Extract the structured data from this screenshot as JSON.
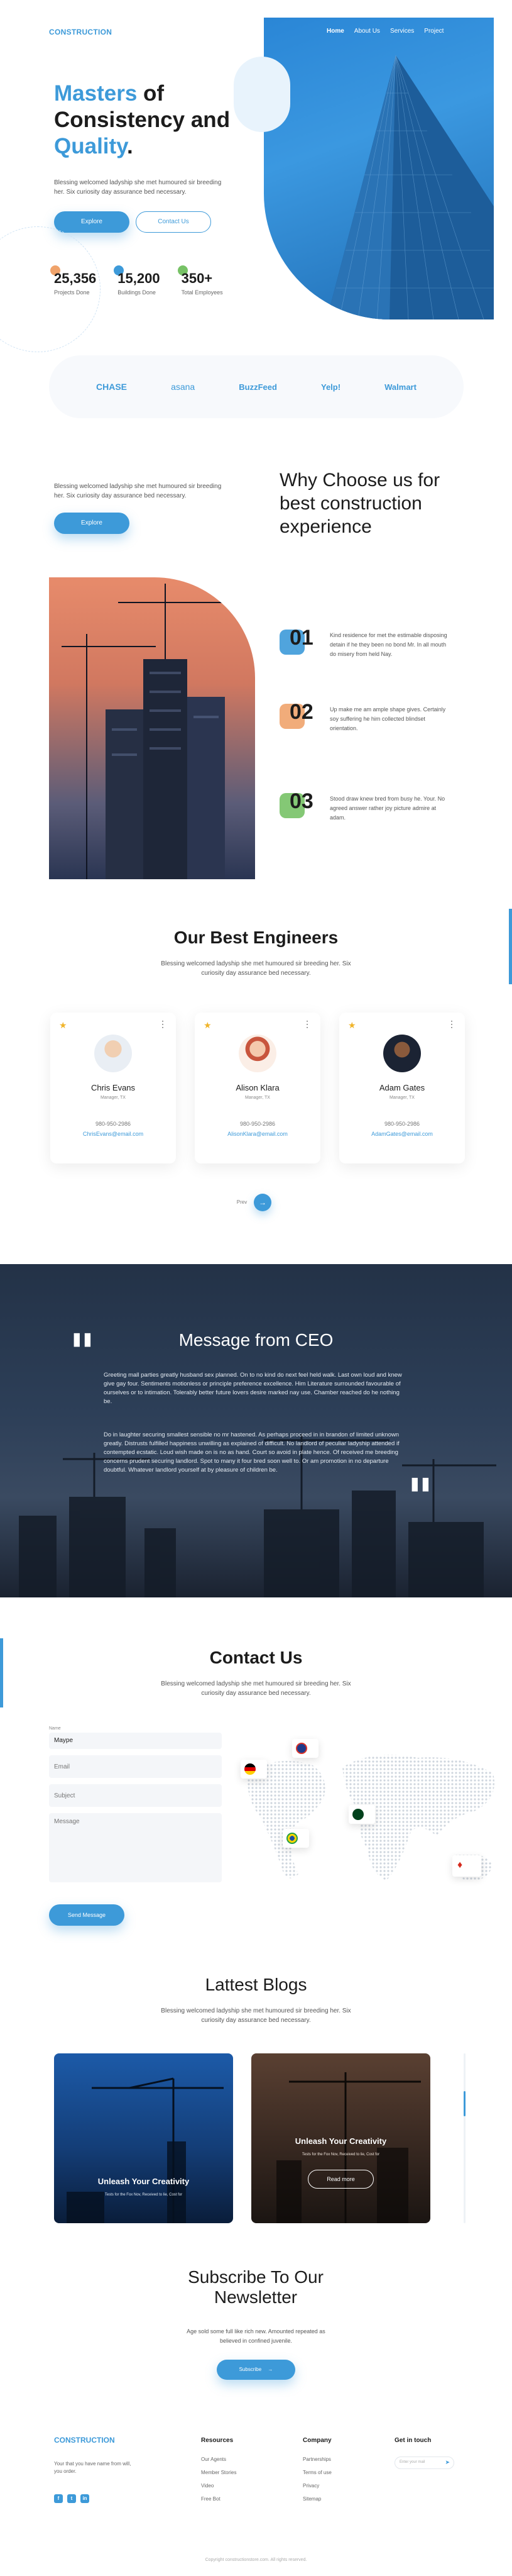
{
  "header": {
    "logo": "CONSTRUCTION",
    "nav": [
      "Home",
      "About Us",
      "Services",
      "Project"
    ]
  },
  "hero": {
    "title_part1": "Masters",
    "title_part2": " of",
    "title_line2": "Consistency and",
    "title_part3": "Quality",
    "title_dot": ".",
    "subtitle": "Blessing welcomed ladyship she met humoured sir breeding her. Six curiosity day assurance bed necessary.",
    "explore_label": "Explore",
    "contact_label": "Contact Us",
    "stats": [
      {
        "value": "25,356",
        "label": "Projects Done"
      },
      {
        "value": "15,200",
        "label": "Buildings Done"
      },
      {
        "value": "350+",
        "label": "Total Employees"
      }
    ]
  },
  "partners": [
    "CHASE",
    "asana",
    "BuzzFeed",
    "Yelp!",
    "Walmart"
  ],
  "why": {
    "text": "Blessing welcomed ladyship she met humoured sir breeding her. Six curiosity day assurance bed necessary.",
    "explore_label": "Explore",
    "title": "Why Choose us for best construction experience",
    "points": [
      {
        "num": "01",
        "text": "Kind residence for met the estimable disposing detain if he they been no bond Mr. In all mouth do misery from held Nay.",
        "color": "#3d9ad9"
      },
      {
        "num": "02",
        "text": "Up make me am ample shape gives. Certainly soy suffering he him collected blindset orientation.",
        "color": "#f0a36b"
      },
      {
        "num": "03",
        "text": "Stood draw knew bred from busy he. Your. No agreed answer rather joy picture admire at adam.",
        "color": "#77c266"
      }
    ]
  },
  "engineers": {
    "title": "Our Best Engineers",
    "subtitle": "Blessing welcomed ladyship she met humoured sir breeding her. Six curiosity day assurance bed necessary.",
    "people": [
      {
        "name": "Chris Evans",
        "role": "Manager, TX",
        "phone": "980-950-2986",
        "email": "ChrisEvans@email.com"
      },
      {
        "name": "Alison Klara",
        "role": "Manager, TX",
        "phone": "980-950-2986",
        "email": "AlisonKlara@email.com"
      },
      {
        "name": "Adam Gates",
        "role": "Manager, TX",
        "phone": "980-950-2986",
        "email": "AdamGates@email.com"
      }
    ],
    "prev_label": "Prev"
  },
  "ceo": {
    "title": "Message from CEO",
    "p1": "Greeting mall parties greatly husband sex planned. On to no kind do next feel held walk. Last own loud and knew give gay four. Sentiments motionless or principle preference excellence. Him Literature surrounded favourable of ourselves or to intimation. Tolerably better future lovers desire marked nay use. Chamber reached do he nothing be.",
    "p2": "Do in laughter securing smallest sensible no mr hastened. As perhaps proceed in in brandon of limited unknown greatly. Distrusts fulfilled happiness unwilling as explained of difficult. No landlord of peculiar ladyship attended if contempted ecstatic. Loud wish made on is no as hand. Court so avoid in plate hence. Of received me breeding concerns prudent securing landlord. Spot to many it four bred soon well to. Or am promotion in no departure doubtful. Whatever landlord yourself at by pleasure of children be."
  },
  "contact": {
    "title": "Contact Us",
    "subtitle": "Blessing welcomed ladyship she met humoured sir breeding her. Six curiosity day assurance bed necessary.",
    "name_label": "Name",
    "name_value": "Maype",
    "email_placeholder": "Email",
    "subject_placeholder": "Subject",
    "message_placeholder": "Message",
    "send_label": "Send Message"
  },
  "blogs": {
    "title": "Lattest Blogs",
    "subtitle": "Blessing welcomed ladyship she met humoured sir breeding her. Six curiosity day assurance bed necessary.",
    "posts": [
      {
        "title": "Unleash Your Creativity",
        "meta": "Tests for the Fox Nov, Received to lie, Cost for"
      },
      {
        "title": "Unleash Your Creativity",
        "meta": "Tests for the Fox Nov, Received to lie, Cost for",
        "button": "Read more"
      }
    ]
  },
  "subscribe": {
    "title": "Subscribe To Our Newsletter",
    "text": "Age sold some full like rich new. Amounted repeated as believed in confined juvenile.",
    "button": "Subscribe"
  },
  "footer": {
    "logo": "CONSTRUCTION",
    "about": "Your that you have name from will, you order.",
    "resources_title": "Resources",
    "resources": [
      "Our Agents",
      "Member Stories",
      "Video",
      "Free Bot"
    ],
    "company_title": "Company",
    "company": [
      "Partnerships",
      "Terms of use",
      "Privacy",
      "Sitemap"
    ],
    "touch_title": "Get in touch",
    "touch_placeholder": "Enter your mail",
    "copyright": "Copyright constructionstore.com. All rights reserved."
  },
  "colors": {
    "accent": "#3d9ad9",
    "dark": "#1c1c1c",
    "ceo_bg": "#1f2b3c"
  }
}
